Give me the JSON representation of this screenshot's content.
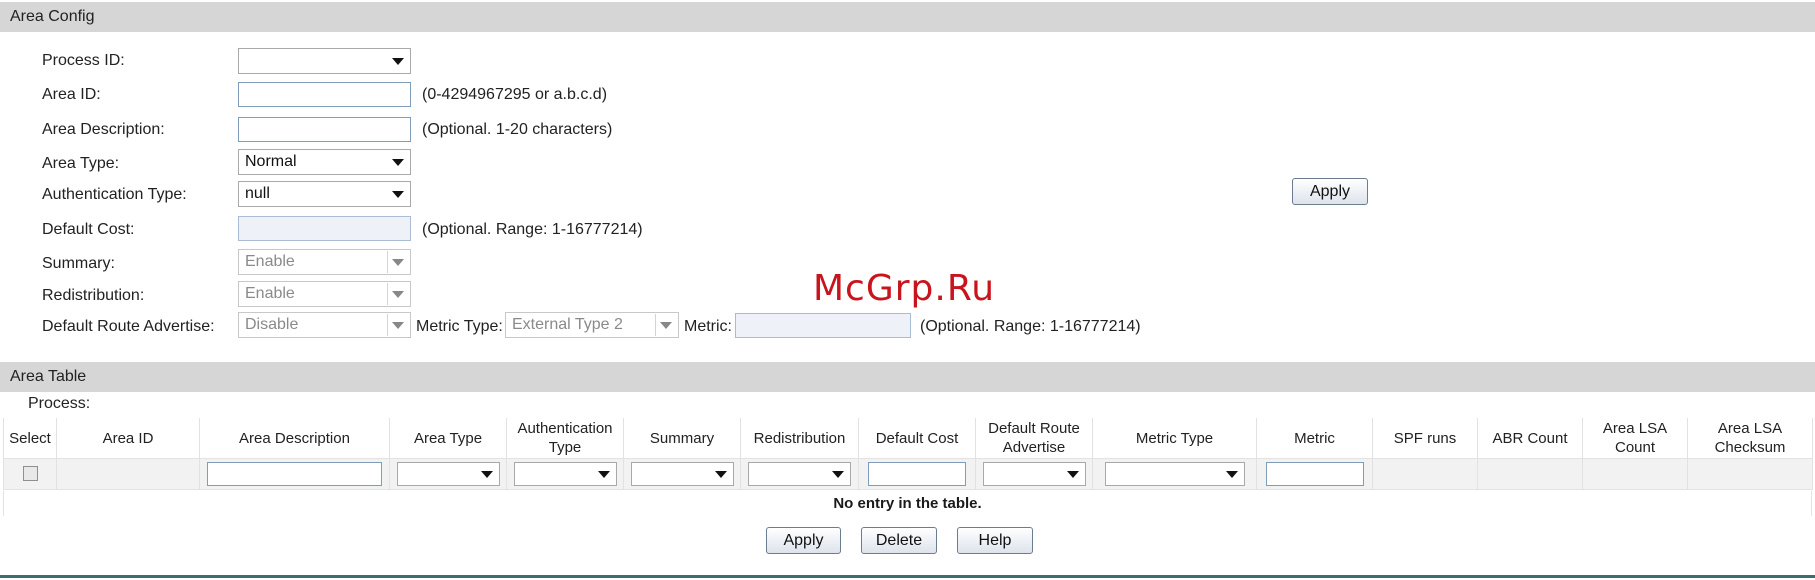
{
  "area_config": {
    "header": "Area Config",
    "process_id": {
      "label": "Process ID:",
      "value": ""
    },
    "area_id": {
      "label": "Area ID:",
      "value": "",
      "hint": "(0-4294967295 or a.b.c.d)"
    },
    "area_description": {
      "label": "Area Description:",
      "value": "",
      "hint": "(Optional. 1-20 characters)"
    },
    "area_type": {
      "label": "Area Type:",
      "value": "Normal"
    },
    "authentication_type": {
      "label": "Authentication Type:",
      "value": "null"
    },
    "default_cost": {
      "label": "Default Cost:",
      "value": "",
      "hint": "(Optional. Range: 1-16777214)"
    },
    "summary": {
      "label": "Summary:",
      "value": "Enable"
    },
    "redistribution": {
      "label": "Redistribution:",
      "value": "Enable"
    },
    "default_route_advertise": {
      "label": "Default Route Advertise:",
      "value": "Disable"
    },
    "metric_type": {
      "label": "Metric Type:",
      "value": "External Type 2"
    },
    "metric": {
      "label": "Metric:",
      "value": "",
      "hint": "(Optional. Range: 1-16777214)"
    },
    "apply_label": "Apply"
  },
  "watermark": "McGrp.Ru",
  "area_table": {
    "header": "Area Table",
    "process_label": "Process:",
    "columns": [
      "Select",
      "Area ID",
      "Area Description",
      "Area Type",
      "Authentication Type",
      "Summary",
      "Redistribution",
      "Default Cost",
      "Default Route Advertise",
      "Metric Type",
      "Metric",
      "SPF runs",
      "ABR Count",
      "Area LSA Count",
      "Area LSA Checksum"
    ],
    "empty_message": "No entry in the table.",
    "buttons": {
      "apply": "Apply",
      "delete": "Delete",
      "help": "Help"
    }
  }
}
